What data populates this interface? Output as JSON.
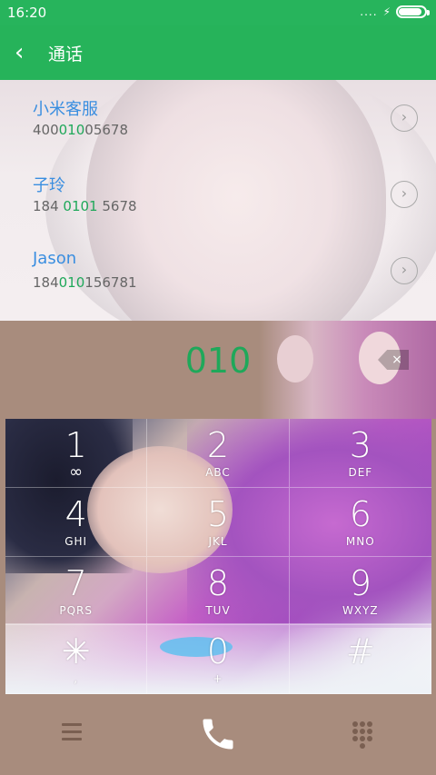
{
  "status_bar": {
    "time": "16:20",
    "signal_text": "....",
    "charging_glyph": "⚡",
    "battery_level": 0.9
  },
  "app_bar": {
    "back_glyph": "‹",
    "title": "通话"
  },
  "results": [
    {
      "name": "小米客服",
      "number_parts": [
        "400",
        "010",
        "05678"
      ]
    },
    {
      "name": "子玲",
      "number_parts": [
        "184 ",
        "0101",
        " 5678"
      ]
    },
    {
      "name": "Jason",
      "number_parts": [
        "184",
        "010",
        "156781"
      ]
    }
  ],
  "entry": {
    "digits": "010",
    "clear_glyph": "×"
  },
  "keypad": [
    {
      "digit": "1",
      "letters": "",
      "sub_icon": "voicemail-icon"
    },
    {
      "digit": "2",
      "letters": "ABC"
    },
    {
      "digit": "3",
      "letters": "DEF"
    },
    {
      "digit": "4",
      "letters": "GHI"
    },
    {
      "digit": "5",
      "letters": "JKL"
    },
    {
      "digit": "6",
      "letters": "MNO"
    },
    {
      "digit": "7",
      "letters": "PQRS"
    },
    {
      "digit": "8",
      "letters": "TUV"
    },
    {
      "digit": "9",
      "letters": "WXYZ"
    },
    {
      "digit": "✳",
      "letters": ","
    },
    {
      "digit": "0",
      "letters": "+"
    },
    {
      "digit": "#",
      "letters": ""
    }
  ],
  "colors": {
    "accent_green": "#26b35a",
    "match_highlight": "#1fa85a",
    "name_blue": "#3a8ee0",
    "panel_brown": "#a88c7d"
  }
}
